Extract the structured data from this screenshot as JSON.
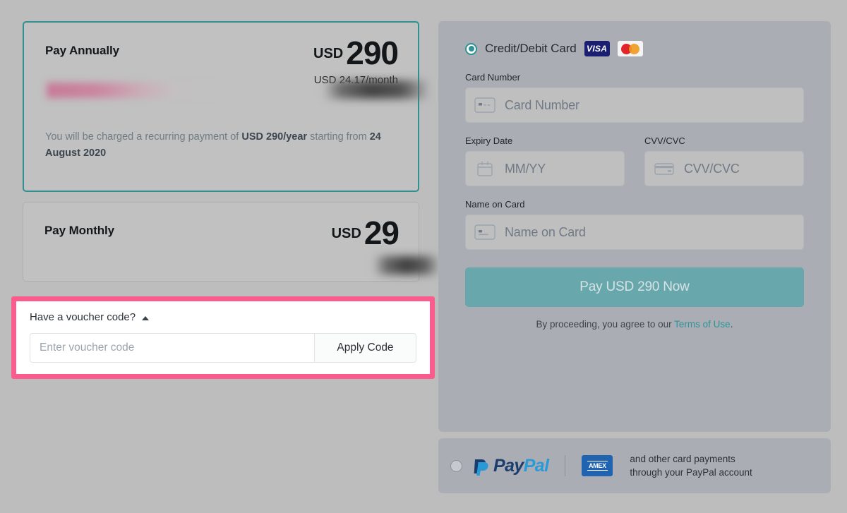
{
  "plans": {
    "annual": {
      "title": "Pay Annually",
      "currency": "USD",
      "amount": "290",
      "per_month": "USD 24.17/month",
      "note_prefix": "You will be charged a recurring payment of ",
      "note_amount": "USD 290/year",
      "note_middle": " starting from ",
      "note_date": "24 August 2020",
      "selected": true,
      "redacted_label": "blurred-text",
      "redacted_price": "blurred-price"
    },
    "monthly": {
      "title": "Pay Monthly",
      "currency": "USD",
      "amount": "29",
      "selected": false,
      "redacted_price": "blurred-price"
    }
  },
  "voucher": {
    "header_label": "Have a voucher code?",
    "toggle_icon": "triangle-up-icon",
    "input_placeholder": "Enter voucher code",
    "input_value": "",
    "apply_label": "Apply Code",
    "highlight_color": "#fb5b8d"
  },
  "payment": {
    "card_method": {
      "label": "Credit/Debit Card",
      "selected": true,
      "logos": [
        "VISA",
        "mastercard-icon"
      ],
      "visa_text": "VISA"
    },
    "fields": {
      "card_number": {
        "label": "Card Number",
        "placeholder": "Card Number",
        "value": "",
        "icon": "credit-card-icon"
      },
      "expiry": {
        "label": "Expiry Date",
        "placeholder": "MM/YY",
        "value": "",
        "icon": "calendar-icon"
      },
      "cvv": {
        "label": "CVV/CVC",
        "placeholder": "CVV/CVC",
        "value": "",
        "icon": "card-stripe-icon"
      },
      "name_on_card": {
        "label": "Name on Card",
        "placeholder": "Name on Card",
        "value": "",
        "icon": "card-name-icon"
      }
    },
    "pay_button_label": "Pay USD 290 Now",
    "terms_prefix": "By proceeding, you agree to our ",
    "terms_link": "Terms of Use",
    "terms_suffix": ".",
    "accent_color": "#2e9296",
    "button_color": "#68a8ad"
  },
  "paypal": {
    "selected": false,
    "wordmark_first": "Pay",
    "wordmark_second": "Pal",
    "amex_label": "AMEX",
    "description_line1": "and other card payments",
    "description_line2": "through your PayPal account"
  }
}
